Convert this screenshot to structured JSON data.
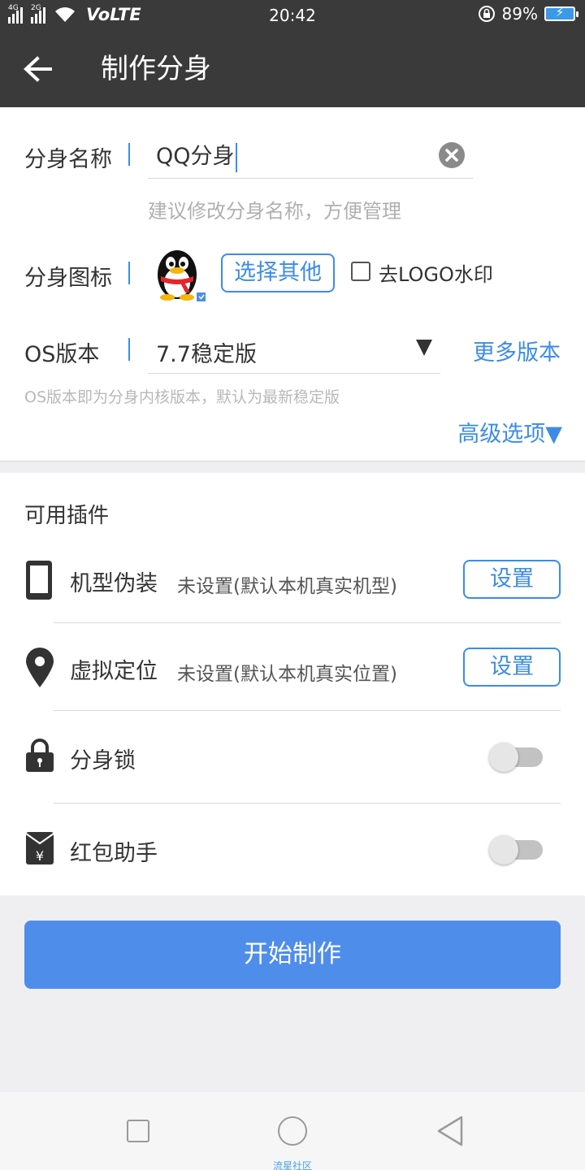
{
  "status_bar": {
    "network_primary": "4G",
    "network_secondary": "2G",
    "volte": "VoLTE",
    "time": "20:42",
    "battery_percent": "89%"
  },
  "app_bar": {
    "title": "制作分身",
    "back_icon": "arrow-left-icon"
  },
  "form": {
    "name_label": "分身名称",
    "name_value": "QQ分身",
    "name_hint": "建议修改分身名称，方便管理",
    "icon_label": "分身图标",
    "choose_other": "选择其他",
    "remove_logo_label": "去LOGO水印",
    "remove_logo_checked": false,
    "os_label": "OS版本",
    "os_value": "7.7稳定版",
    "more_versions": "更多版本",
    "os_hint": "OS版本即为分身内核版本，默认为最新稳定版",
    "advanced": "高级选项▼"
  },
  "plugins": {
    "title": "可用插件",
    "items": [
      {
        "name": "机型伪装",
        "status": "未设置(默认本机真实机型)",
        "action": "设置",
        "icon": "phone-icon"
      },
      {
        "name": "虚拟定位",
        "status": "未设置(默认本机真实位置)",
        "action": "设置",
        "icon": "location-pin-icon"
      },
      {
        "name": "分身锁",
        "icon": "lock-icon",
        "enabled": false
      },
      {
        "name": "红包助手",
        "icon": "red-envelope-icon",
        "enabled": false
      }
    ]
  },
  "start_button": "开始制作",
  "nav_bar": {
    "watermark": "流星社区"
  },
  "colors": {
    "accent": "#3c8ce6",
    "button_primary": "#4f8deb",
    "app_bar": "#3a3a3a"
  }
}
